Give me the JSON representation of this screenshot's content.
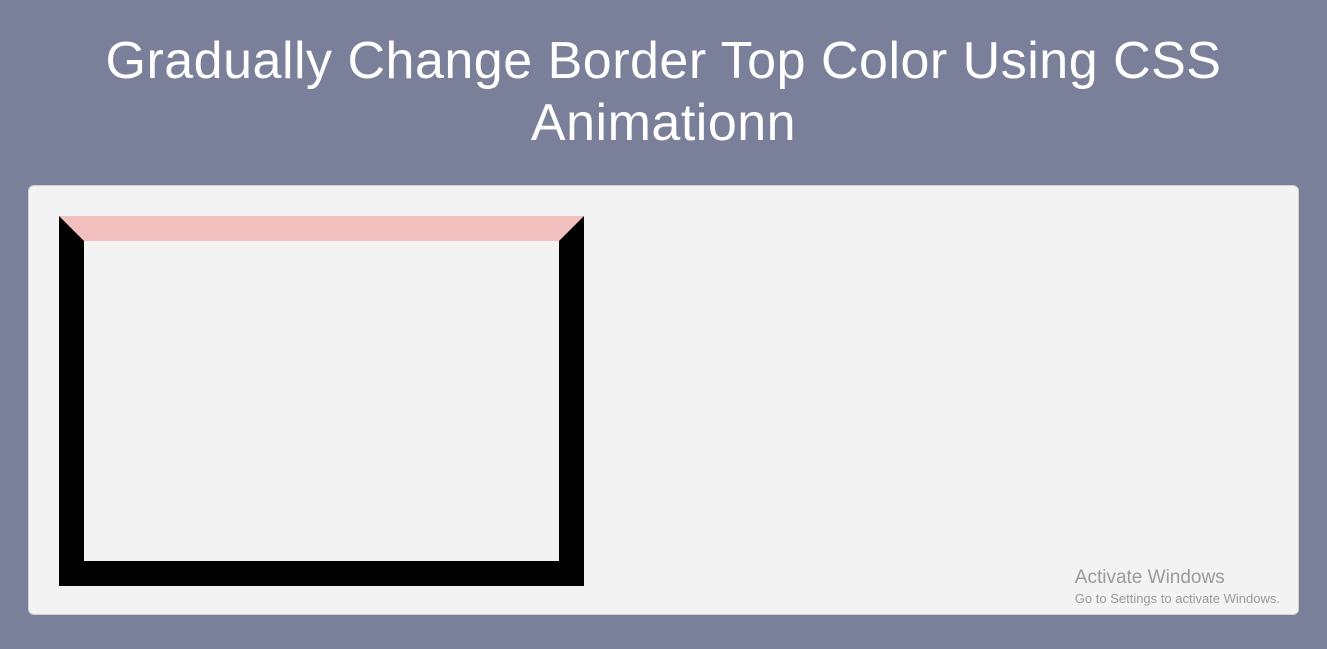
{
  "header": {
    "title": "Gradually Change Border Top Color Using CSS Animationn"
  },
  "demo": {
    "border_top_color": "#f1c0bf",
    "border_other_color": "#000000"
  },
  "watermark": {
    "title": "Activate Windows",
    "subtitle": "Go to Settings to activate Windows."
  }
}
